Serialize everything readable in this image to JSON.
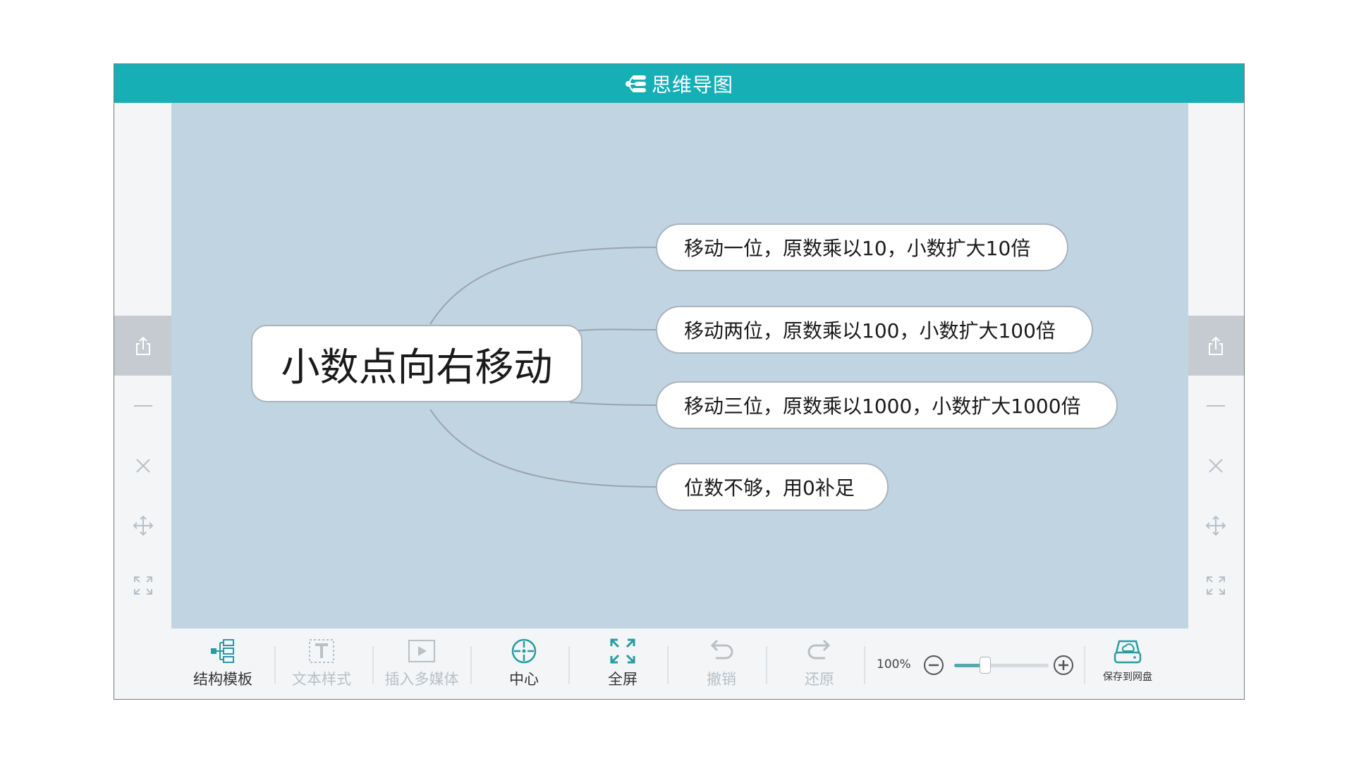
{
  "header": {
    "title": "思维导图"
  },
  "mindmap": {
    "root": "小数点向右移动",
    "children": [
      "移动一位，原数乘以10，小数扩大10倍",
      "移动两位，原数乘以100，小数扩大100倍",
      "移动三位，原数乘以1000，小数扩大1000倍",
      "位数不够，用0补足"
    ]
  },
  "sidebar": {
    "items": [
      "share-icon",
      "minimize-icon",
      "close-icon",
      "move-icon",
      "expand-icon"
    ]
  },
  "toolbar": {
    "structure_label": "结构模板",
    "text_style_label": "文本样式",
    "insert_media_label": "插入多媒体",
    "center_label": "中心",
    "fullscreen_label": "全屏",
    "undo_label": "撤销",
    "redo_label": "还原",
    "zoom_value": "100%",
    "zoom_level": 0.33,
    "save_label": "保存到网盘"
  },
  "colors": {
    "header_bg": "#15afb5",
    "canvas_bg": "#c0d4e2",
    "accent": "#2a9ca1",
    "disabled": "#b9c0c6"
  }
}
